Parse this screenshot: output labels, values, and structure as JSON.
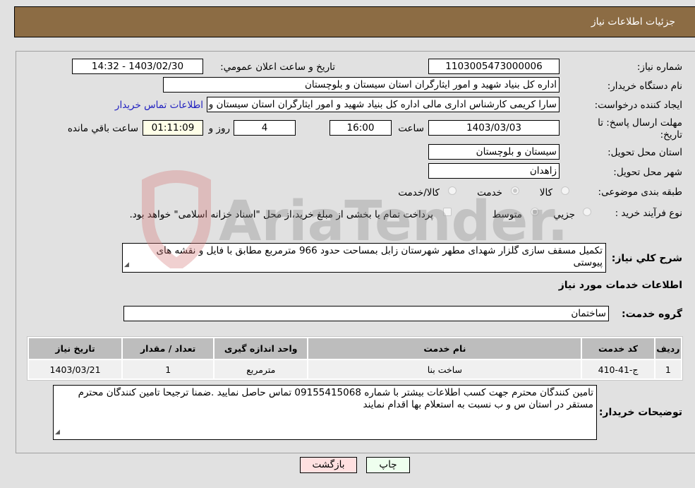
{
  "header": {
    "title": "جزئيات اطلاعات نياز"
  },
  "form": {
    "need_number": {
      "label": "شماره نياز:",
      "value": "1103005473000006"
    },
    "announce_datetime": {
      "label": "تاريخ و ساعت اعلان عمومي:",
      "value": "1403/02/30 - 14:32"
    },
    "buyer_org": {
      "label": "نام دستگاه خريدار:",
      "value": "اداره کل بنیاد شهید و امور ایثارگران استان سیستان و بلوچستان"
    },
    "requester": {
      "label": "ايجاد کننده درخواست:",
      "value": "سارا کریمی کارشناس اداری مالی اداره کل بنیاد شهید و امور ایثارگران استان سیستان و بلوچستان",
      "contact_link": "اطلاعات تماس خريدار"
    },
    "deadline": {
      "label": "مهلت ارسال پاسخ: تا تاريخ:",
      "date": "1403/03/03",
      "time_label": "ساعت",
      "time": "16:00",
      "days": "4",
      "days_label": "روز و",
      "remaining": "01:11:09",
      "remaining_label": "ساعت باقي مانده"
    },
    "delivery_province": {
      "label": "استان محل تحويل:",
      "value": "سيستان و بلوچستان"
    },
    "delivery_city": {
      "label": "شهر محل تحويل:",
      "value": "زاهدان"
    },
    "category": {
      "label": "طبقه بندی موضوعی:",
      "options": [
        {
          "label": "كالا",
          "checked": false
        },
        {
          "label": "خدمت",
          "checked": true
        },
        {
          "label": "كالا/خدمت",
          "checked": false
        }
      ]
    },
    "purchase_process": {
      "label": "نوع فرآيند خريد :",
      "options": [
        {
          "label": "جزيي",
          "checked": false
        },
        {
          "label": "متوسط",
          "checked": true
        }
      ],
      "treasury_note": "پرداخت تمام يا بخشی از مبلغ خريد،از محل \"اسناد خزانه اسلامی\" خواهد بود."
    }
  },
  "description": {
    "label": "شرح كلي نياز:",
    "value": "تکمیل مسقف سازی گلزار شهدای مطهر شهرستان زابل بمساحت حدود 966 مترمربع مطابق با فایل و نقشه های پیوستی"
  },
  "services": {
    "section_title": "اطلاعات خدمات مورد نياز",
    "group_label": "گروه خدمت:",
    "group_value": "ساختمان",
    "columns": [
      "رديف",
      "كد خدمت",
      "نام خدمت",
      "واحد اندازه گيری",
      "تعداد / مقدار",
      "تاريخ نياز"
    ],
    "rows": [
      [
        "1",
        "ج-41-410",
        "ساخت بنا",
        "مترمربع",
        "1",
        "1403/03/21"
      ]
    ]
  },
  "buyer_notes": {
    "label": "توضيحات خريدار:",
    "value": "تامین کنندگان محترم جهت کسب اطلاعات بیشتر با شماره 09155415068 تماس حاصل نمایید .ضمنا ترجیحا تامین کنندگان محترم مستقر در استان س و ب نسبت به استعلام بها اقدام نمایند"
  },
  "buttons": {
    "print": "چاپ",
    "back": "بازگشت"
  },
  "watermark": {
    "text": "AriaTender.neT"
  },
  "colors": {
    "header_bg": "#8c6c44",
    "print_bg": "#eeffee",
    "back_bg": "#ffe0e0",
    "link": "#2020c0"
  }
}
